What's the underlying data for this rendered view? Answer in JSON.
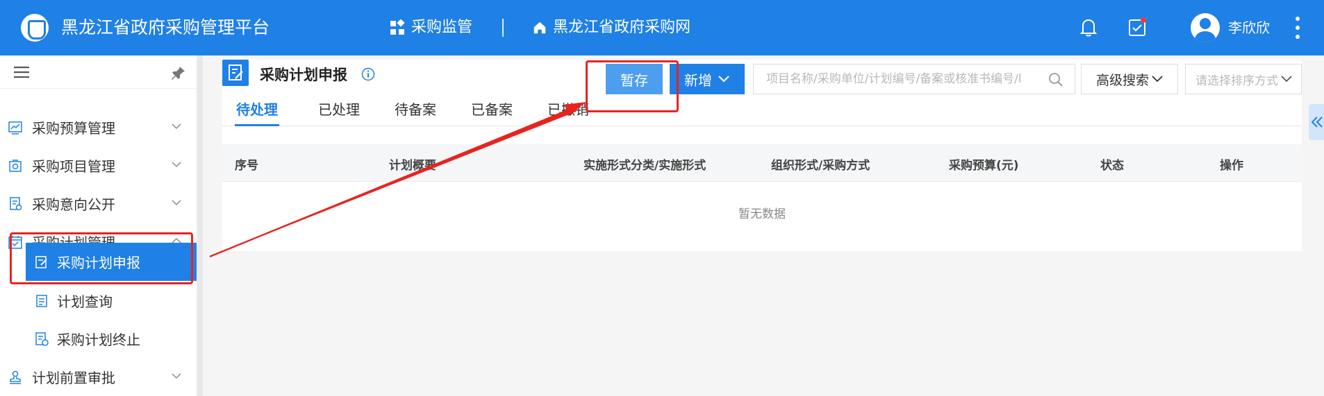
{
  "header": {
    "app_title": "黑龙江省政府采购管理平台",
    "nav": [
      {
        "label": "采购监管",
        "icon": "grid-icon"
      },
      {
        "label": "黑龙江省政府采购网",
        "icon": "home-icon"
      }
    ],
    "user_name": "李欣欣"
  },
  "sidebar": {
    "items": [
      {
        "label": "采购预算管理",
        "icon": "chart-icon",
        "expanded": false
      },
      {
        "label": "采购项目管理",
        "icon": "camera-icon",
        "expanded": false
      },
      {
        "label": "采购意向公开",
        "icon": "document-icon",
        "expanded": false
      },
      {
        "label": "采购计划管理",
        "icon": "calendar-icon",
        "expanded": true
      },
      {
        "label": "采购计划申报",
        "icon": "edit-icon",
        "active": true
      },
      {
        "label": "计划查询",
        "icon": "list-icon"
      },
      {
        "label": "采购计划终止",
        "icon": "file-stop-icon"
      },
      {
        "label": "计划前置审批",
        "icon": "stamp-icon",
        "expanded": false
      }
    ]
  },
  "main": {
    "page_title": "采购计划申报",
    "toolbar": {
      "save_label": "暂存",
      "add_label": "新增",
      "search_placeholder": "项目名称/采购单位/计划编号/备案或核准书编号/l",
      "advanced_search_label": "高级搜索",
      "sort_placeholder": "请选择排序方式"
    },
    "tabs": [
      {
        "label": "待处理",
        "active": true
      },
      {
        "label": "已处理"
      },
      {
        "label": "待备案"
      },
      {
        "label": "已备案"
      },
      {
        "label": "已撤销"
      }
    ],
    "table": {
      "columns": [
        "序号",
        "计划概要",
        "实施形式分类/实施形式",
        "组织形式/采购方式",
        "采购预算(元)",
        "状态",
        "操作"
      ],
      "empty_text": "暂无数据"
    }
  },
  "colors": {
    "primary": "#1f80e6",
    "annotation": "#e8231f"
  }
}
